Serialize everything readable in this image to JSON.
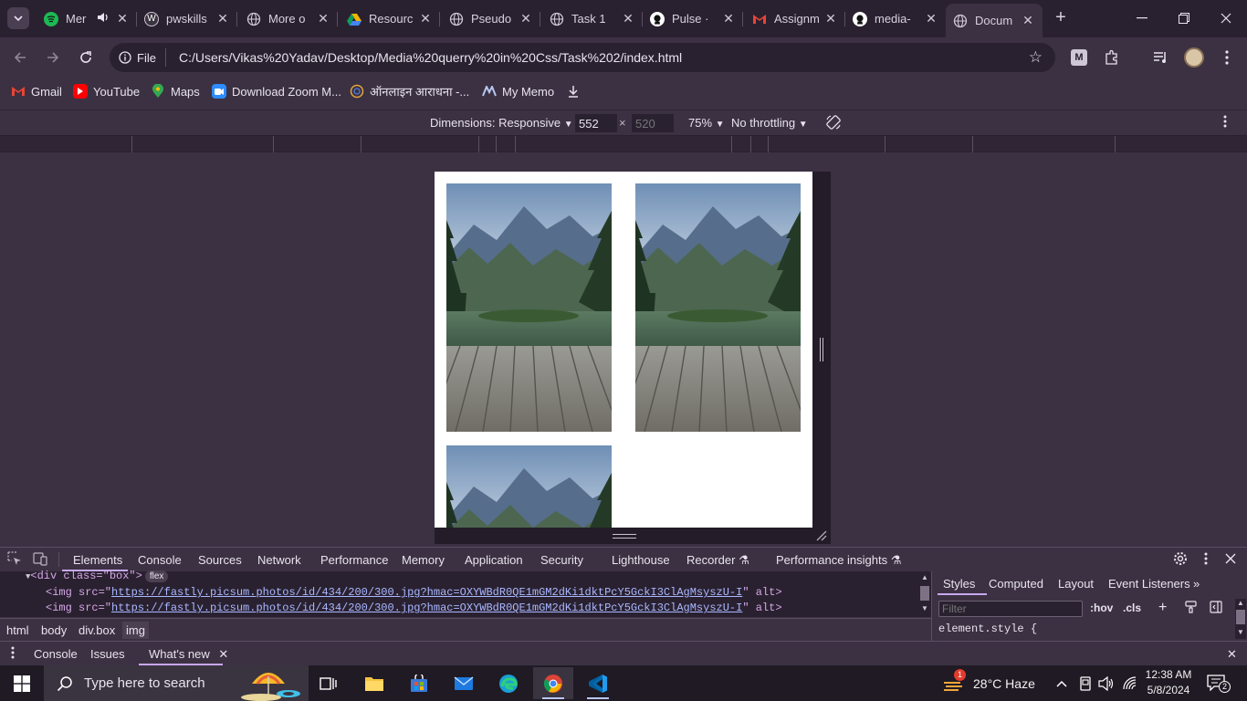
{
  "tabs": [
    {
      "title": "Mer",
      "fav": "spotify-icon",
      "color": "#1db954",
      "extra": "audio"
    },
    {
      "title": "pwskills",
      "fav": "wordpress-icon",
      "color": "#ffffff"
    },
    {
      "title": "More o",
      "fav": "globe-icon",
      "color": "#cfc7d6"
    },
    {
      "title": "Resourc",
      "fav": "drive-icon",
      "color": "#f4b400"
    },
    {
      "title": "Pseudo",
      "fav": "globe-icon",
      "color": "#cfc7d6"
    },
    {
      "title": "Task 1",
      "fav": "globe-icon",
      "color": "#cfc7d6"
    },
    {
      "title": "Pulse · ",
      "fav": "github-icon",
      "color": "#ffffff"
    },
    {
      "title": "Assignm",
      "fav": "gmail-icon",
      "color": "#ea4335"
    },
    {
      "title": "media-",
      "fav": "github-icon",
      "color": "#ffffff"
    },
    {
      "title": "Docum",
      "fav": "globe-icon",
      "color": "#cfc7d6",
      "active": true
    }
  ],
  "toolbar": {
    "file_label": "File",
    "url": "C:/Users/Vikas%20Yadav/Desktop/Media%20querry%20in%20Css/Task%202/index.html"
  },
  "bookmarks": [
    {
      "label": "Gmail",
      "icon": "gmail-icon"
    },
    {
      "label": "YouTube",
      "icon": "youtube-icon"
    },
    {
      "label": "Maps",
      "icon": "maps-icon"
    },
    {
      "label": "Download Zoom M...",
      "icon": "zoom-icon"
    },
    {
      "label": "ऑनलाइन आराधना -...",
      "icon": "aradhana-icon"
    },
    {
      "label": "My Memo",
      "icon": "memo-icon"
    }
  ],
  "device_toolbar": {
    "dimensions_label": "Dimensions: Responsive",
    "width": "552",
    "times": "×",
    "height": "520",
    "zoom": "75%",
    "throttling": "No throttling"
  },
  "devtools": {
    "tabs": [
      "Elements",
      "Console",
      "Sources",
      "Network",
      "Performance",
      "Memory",
      "Application",
      "Security",
      "Lighthouse",
      "Recorder",
      "Performance insights"
    ],
    "code": {
      "div_open": "<div class=\"box\">",
      "flex_badge": "flex",
      "img_prefix": "<img src=\"",
      "img_url": "https://fastly.picsum.photos/id/434/200/300.jpg?hmac=OXYWBdR0QE1mGM2dKi1dktPcY5GckI3ClAgMsyszU-I",
      "img_suffix": "\" alt>"
    },
    "breadcrumbs": [
      "html",
      "body",
      "div.box",
      "img"
    ],
    "styles_tabs": [
      "Styles",
      "Computed",
      "Layout",
      "Event Listeners"
    ],
    "filter_placeholder": "Filter",
    "hov": ":hov",
    "cls": ".cls",
    "element_style": "element.style {",
    "drawer_tabs": [
      "Console",
      "Issues",
      "What's new"
    ]
  },
  "taskbar": {
    "search_placeholder": "Type here to search",
    "weather": "28°C  Haze",
    "weather_badge": "1",
    "time": "12:38 AM",
    "date": "5/8/2024",
    "notifications": "2"
  }
}
